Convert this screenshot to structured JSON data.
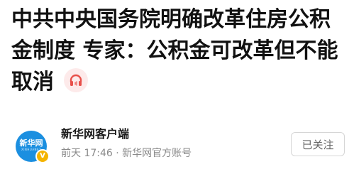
{
  "article": {
    "headline": "中共中央国务院明确改革住房公积金制度 专家：公积金可改革但不能取消",
    "audio_icon": "headphones-icon"
  },
  "source": {
    "avatar_text": "新华网",
    "avatar_subtext": "XINHUANET",
    "verified_mark": "V",
    "name": "新华网客户端",
    "time": "前天 17:46",
    "separator": "·",
    "account_type": "新华网官方账号",
    "follow_label": "已关注"
  },
  "colors": {
    "accent": "#e8504a",
    "avatar_bg": "#1b8fe0",
    "badge": "#f4b400"
  }
}
